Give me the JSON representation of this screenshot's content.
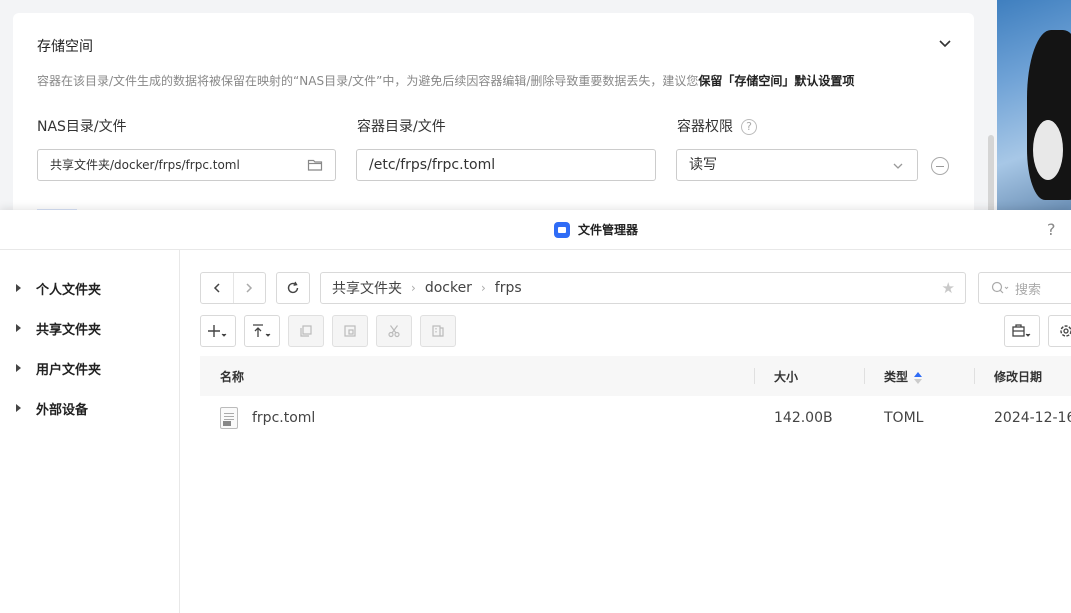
{
  "settings": {
    "section_title": "存储空间",
    "description_prefix": "容器在该目录/文件生成的数据将被保留在映射的“NAS目录/文件”中，为避免后续因容器编辑/删除导致重要数据丢失，建议您",
    "description_bold": "保留「存储空间」默认设置项",
    "nas_label": "NAS目录/文件",
    "container_label": "容器目录/文件",
    "permission_label": "容器权限",
    "nas_value": "共享文件夹/docker/frps/frpc.toml",
    "container_value": "/etc/frps/frpc.toml",
    "permission_value": "读写",
    "help_glyph": "?"
  },
  "window": {
    "title": "文件管理器",
    "help_glyph": "?"
  },
  "sidebar": {
    "items": [
      {
        "label": "个人文件夹"
      },
      {
        "label": "共享文件夹"
      },
      {
        "label": "用户文件夹"
      },
      {
        "label": "外部设备"
      }
    ]
  },
  "breadcrumb": {
    "parts": [
      "共享文件夹",
      "docker",
      "frps"
    ],
    "separator": "›"
  },
  "search": {
    "placeholder": "搜索"
  },
  "table": {
    "columns": {
      "name": "名称",
      "size": "大小",
      "type": "类型",
      "modified": "修改日期"
    },
    "rows": [
      {
        "name": "frpc.toml",
        "size": "142.00B",
        "type": "TOML",
        "modified": "2024-12-16"
      }
    ],
    "sort_column": "type"
  },
  "icons": {
    "nav_back": "chevron-left-icon",
    "nav_forward": "chevron-right-icon",
    "refresh": "refresh-icon",
    "star": "star-icon",
    "search": "search-icon",
    "new": "plus-icon",
    "upload": "upload-icon",
    "copy": "copy-icon",
    "paste": "paste-icon",
    "cut": "scissors-icon",
    "compress": "archive-icon",
    "view": "briefcase-icon",
    "settings": "gear-icon",
    "folder": "folder-icon",
    "file": "file-icon"
  },
  "colors": {
    "accent": "#2f6cf6"
  }
}
